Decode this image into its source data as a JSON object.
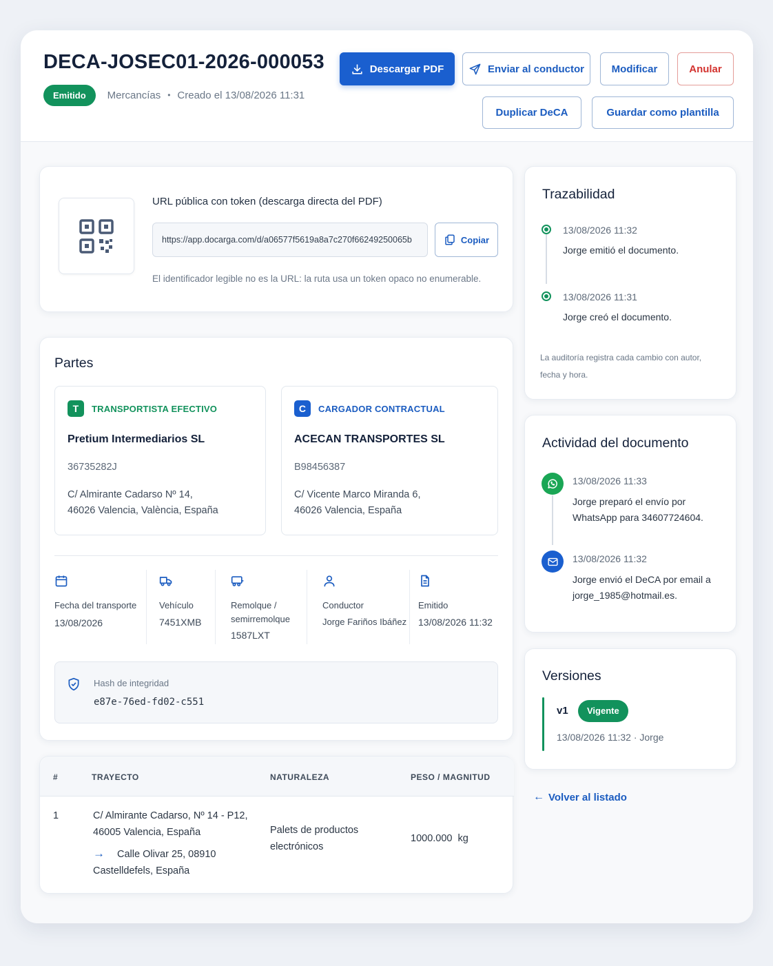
{
  "header": {
    "doc_id": "DECA-JOSEC01-2026-000053",
    "status": "Emitido",
    "category": "Mercancías",
    "separator": "•",
    "created": "Creado el 13/08/2026 11:31",
    "actions": {
      "download": "Descargar PDF",
      "send_driver": "Enviar al conductor",
      "modify": "Modificar",
      "cancel": "Anular",
      "duplicate": "Duplicar DeCA",
      "save_template": "Guardar como plantilla"
    }
  },
  "public_url": {
    "label": "URL pública con token (descarga directa del PDF)",
    "value": "https://app.docarga.com/d/a06577f5619a8a7c270f66249250065b",
    "copy_label": "Copiar",
    "hint": "El identificador legible no es la URL: la ruta usa un token opaco no enumerable."
  },
  "parties": {
    "title": "Partes",
    "carrier": {
      "letter": "T",
      "role": "TRANSPORTISTA EFECTIVO",
      "name": "Pretium Intermediarios SL",
      "nif": "36735282J",
      "address_line1": "C/ Almirante Cadarso Nº 14,",
      "address_line2": "46026 Valencia, València, España"
    },
    "shipper": {
      "letter": "C",
      "role": "CARGADOR CONTRACTUAL",
      "name": "ACECAN TRANSPORTES SL",
      "nif": "B98456387",
      "address_line1": "C/ Vicente Marco Miranda 6,",
      "address_line2": "46026 Valencia, España"
    }
  },
  "facts": {
    "date_label": "Fecha del transporte",
    "date_value": "13/08/2026",
    "vehicle_label": "Vehículo",
    "vehicle_value": "7451XMB",
    "trailer_label_1": "Remolque /",
    "trailer_label_2": "semirremolque",
    "trailer_value": "1587LXT",
    "driver_label": "Conductor",
    "driver_value": "Jorge Fariños Ibáñez",
    "issued_label": "Emitido",
    "issued_value": "13/08/2026 11:32"
  },
  "hash": {
    "label": "Hash de integridad",
    "value": "e87e-76ed-fd02-c551"
  },
  "table": {
    "headers": [
      "#",
      "TRAYECTO",
      "NATURALEZA",
      "PESO / MAGNITUD"
    ],
    "rows": [
      {
        "num": "1",
        "origin_line1": "C/ Almirante Cadarso, Nº 14 - P12,",
        "origin_line2": "46005 Valencia, España",
        "arrow": "→",
        "dest_line1": "Calle Olivar 25, 08910",
        "dest_line2": "Castelldefels, España",
        "nature_line1": "Palets de productos",
        "nature_line2": "electrónicos",
        "weight": "1000.000  kg"
      }
    ]
  },
  "traceability": {
    "title": "Trazabilidad",
    "events": [
      {
        "date": "13/08/2026 11:32",
        "text": "Jorge emitió el documento."
      },
      {
        "date": "13/08/2026 11:31",
        "text": "Jorge creó el documento."
      }
    ],
    "note_line1": "La auditoría registra cada cambio con autor,",
    "note_line2": "fecha y hora."
  },
  "activity": {
    "title": "Actividad del documento",
    "events": [
      {
        "date": "13/08/2026 11:33",
        "line1": "Jorge preparó el envío por",
        "line2": "WhatsApp para 34607724604."
      },
      {
        "date": "13/08/2026 11:32",
        "line1": "Jorge envió el DeCA por email a",
        "line2": "jorge_1985@hotmail.es."
      }
    ]
  },
  "versions": {
    "title": "Versiones",
    "items": [
      {
        "label": "v1",
        "badge": "Vigente",
        "meta": "13/08/2026 11:32 · Jorge"
      }
    ]
  },
  "back_link": "Volver al listado",
  "colors": {
    "primary": "#1a5fcf",
    "success": "#12925c",
    "danger": "#d3332f",
    "whatsapp": "#1aa655"
  }
}
